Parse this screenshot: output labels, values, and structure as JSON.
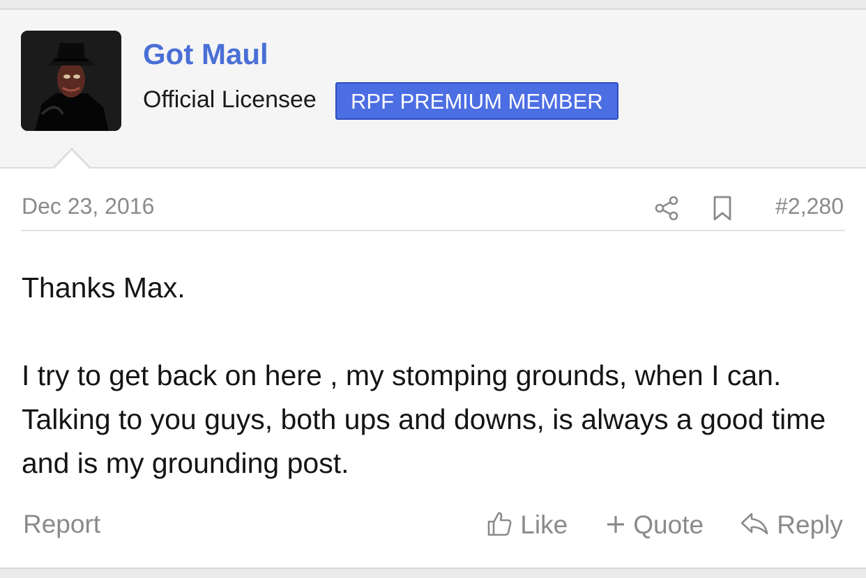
{
  "user": {
    "name": "Got Maul",
    "title": "Official Licensee",
    "banner": "RPF PREMIUM MEMBER"
  },
  "post": {
    "date": "Dec 23, 2016",
    "number": "#2,280",
    "paragraphs": [
      "Thanks Max.",
      "I try to get back on here , my stomping grounds, when I can. Talking to you guys, both ups and downs, is always a good time and is my grounding post."
    ]
  },
  "actions": {
    "report": "Report",
    "like": "Like",
    "quote": "Quote",
    "reply": "Reply"
  },
  "icons": {
    "avatar": "avatar-image",
    "share": "share-icon",
    "bookmark": "bookmark-icon",
    "like": "thumbs-up-icon",
    "quote": "plus-icon",
    "reply": "reply-arrow-icon"
  },
  "colors": {
    "username": "#4a6fd6",
    "banner": "#4c6ee3",
    "muted": "#8a8a8a"
  }
}
